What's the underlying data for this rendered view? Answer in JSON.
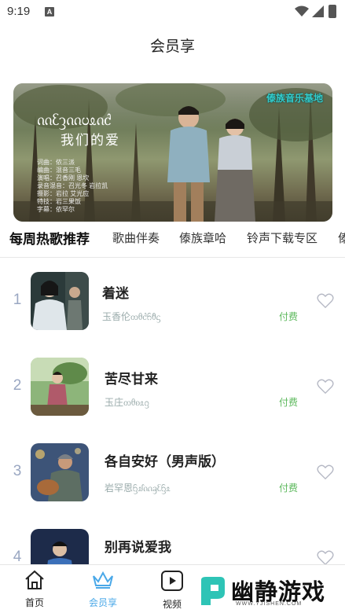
{
  "status_bar": {
    "time": "9:19",
    "notification_icon": "A"
  },
  "header": {
    "title": "会员享"
  },
  "banner": {
    "brand": "傣族音乐基地",
    "title_script": "ᦶᦷᦡᦶᦢᦸᦵᦺ",
    "title_cn": "我们的爱",
    "credits": [
      "词曲：侬三派",
      "编曲：混音三毛",
      "演唱：召香刚 恩坎",
      "录音混音：召光冬 岩拉凯",
      "摄影：岩拉 艾光应",
      "特技：岩三果饭",
      "字幕：依罕尔"
    ]
  },
  "tabs": [
    {
      "label": "每周热歌推荐",
      "active": true
    },
    {
      "label": "歌曲伴奏",
      "active": false
    },
    {
      "label": "傣族章哈",
      "active": false
    },
    {
      "label": "铃声下载专区",
      "active": false
    },
    {
      "label": "傣",
      "active": false
    }
  ],
  "songs": [
    {
      "rank": "1",
      "title": "着迷",
      "artist": "玉香伦ᦎᦲᦺᦆᦹᦓ",
      "price": "付费"
    },
    {
      "rank": "2",
      "title": "苦尽甘来",
      "artist": "玉庄ᦎᦲᦈᦸᦋ",
      "price": "付费"
    },
    {
      "rank": "3",
      "title": "各自安好（男声版）",
      "artist": "岩罕恩ᦌᦾᦶᦃᦷᦌᦸ",
      "price": "付费"
    },
    {
      "rank": "4",
      "title": "别再说爱我",
      "artist": "",
      "price": ""
    }
  ],
  "bottom_nav": [
    {
      "label": "首页",
      "icon": "home-icon",
      "active": false
    },
    {
      "label": "会员享",
      "icon": "crown-icon",
      "active": true
    },
    {
      "label": "视频",
      "icon": "video-icon",
      "active": false
    }
  ],
  "watermark": {
    "text": "幽静游戏",
    "url": "WWW.YJISHEN.COM"
  },
  "colors": {
    "accent": "#4aa8e8",
    "paid": "#5bb85b",
    "rank": "#9aa7c2"
  }
}
